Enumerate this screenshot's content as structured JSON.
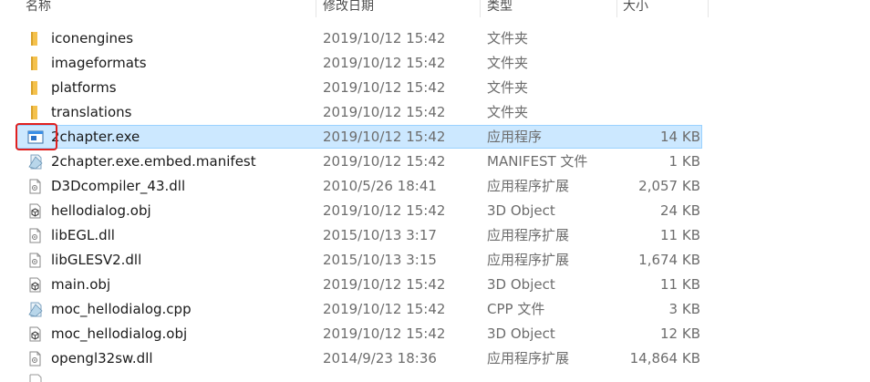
{
  "columns": {
    "name": "名称",
    "date": "修改日期",
    "type": "类型",
    "size": "大小"
  },
  "files": [
    {
      "name": "iconengines",
      "date": "2019/10/12 15:42",
      "type": "文件夹",
      "size": "",
      "icon": "folder-icon"
    },
    {
      "name": "imageformats",
      "date": "2019/10/12 15:42",
      "type": "文件夹",
      "size": "",
      "icon": "folder-icon"
    },
    {
      "name": "platforms",
      "date": "2019/10/12 15:42",
      "type": "文件夹",
      "size": "",
      "icon": "folder-icon"
    },
    {
      "name": "translations",
      "date": "2019/10/12 15:42",
      "type": "文件夹",
      "size": "",
      "icon": "folder-icon"
    },
    {
      "name": "2chapter.exe",
      "date": "2019/10/12 15:42",
      "type": "应用程序",
      "size": "14 KB",
      "icon": "exe-icon",
      "selected": true
    },
    {
      "name": "2chapter.exe.embed.manifest",
      "date": "2019/10/12 15:42",
      "type": "MANIFEST 文件",
      "size": "1 KB",
      "icon": "generic-file-icon"
    },
    {
      "name": "D3Dcompiler_43.dll",
      "date": "2010/5/26 18:41",
      "type": "应用程序扩展",
      "size": "2,057 KB",
      "icon": "dll-icon"
    },
    {
      "name": "hellodialog.obj",
      "date": "2019/10/12 15:42",
      "type": "3D Object",
      "size": "24 KB",
      "icon": "3d-object-icon"
    },
    {
      "name": "libEGL.dll",
      "date": "2015/10/13 3:17",
      "type": "应用程序扩展",
      "size": "11 KB",
      "icon": "dll-icon"
    },
    {
      "name": "libGLESV2.dll",
      "date": "2015/10/13 3:15",
      "type": "应用程序扩展",
      "size": "1,674 KB",
      "icon": "dll-icon"
    },
    {
      "name": "main.obj",
      "date": "2019/10/12 15:42",
      "type": "3D Object",
      "size": "11 KB",
      "icon": "3d-object-icon"
    },
    {
      "name": "moc_hellodialog.cpp",
      "date": "2019/10/12 15:42",
      "type": "CPP 文件",
      "size": "3 KB",
      "icon": "generic-file-icon"
    },
    {
      "name": "moc_hellodialog.obj",
      "date": "2019/10/12 15:42",
      "type": "3D Object",
      "size": "12 KB",
      "icon": "3d-object-icon"
    },
    {
      "name": "opengl32sw.dll",
      "date": "2014/9/23 18:36",
      "type": "应用程序扩展",
      "size": "14,864 KB",
      "icon": "dll-icon"
    }
  ],
  "colors": {
    "selection_bg": "#cce8ff",
    "selection_border": "#99d1ff",
    "highlight_box": "#e0201f",
    "folder": "#f4c14c"
  }
}
